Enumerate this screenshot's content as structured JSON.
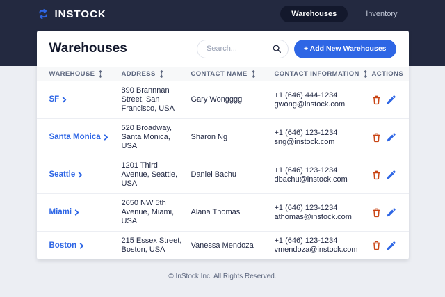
{
  "brand": {
    "name": "INSTOCK"
  },
  "nav": {
    "items": [
      {
        "label": "Warehouses",
        "active": true
      },
      {
        "label": "Inventory",
        "active": false
      }
    ]
  },
  "page": {
    "title": "Warehouses",
    "search_placeholder": "Search...",
    "add_button_label": "+ Add New Warehouses"
  },
  "table": {
    "columns": [
      {
        "label": "WAREHOUSE",
        "sortable": true
      },
      {
        "label": "ADDRESS",
        "sortable": true
      },
      {
        "label": "CONTACT NAME",
        "sortable": true
      },
      {
        "label": "CONTACT INFORMATION",
        "sortable": true
      },
      {
        "label": "ACTIONS",
        "sortable": false
      }
    ],
    "rows": [
      {
        "warehouse": "SF",
        "address": "890 Brannnan Street, San Francisco, USA",
        "contact_name": "Gary Wongggg",
        "phone": "+1 (646) 444-1234",
        "email": "gwong@instock.com"
      },
      {
        "warehouse": "Santa Monica",
        "address": "520 Broadway, Santa Monica, USA",
        "contact_name": "Sharon Ng",
        "phone": "+1 (646) 123-1234",
        "email": "sng@instock.com"
      },
      {
        "warehouse": "Seattle",
        "address": "1201 Third Avenue, Seattle, USA",
        "contact_name": "Daniel Bachu",
        "phone": "+1 (646) 123-1234",
        "email": "dbachu@instock.com"
      },
      {
        "warehouse": "Miami",
        "address": "2650 NW 5th Avenue, Miami, USA",
        "contact_name": "Alana Thomas",
        "phone": "+1 (646) 123-1234",
        "email": "athomas@instock.com"
      },
      {
        "warehouse": "Boston",
        "address": "215 Essex Street, Boston, USA",
        "contact_name": "Vanessa Mendoza",
        "phone": "+1 (646) 123-1234",
        "email": "vmendoza@instock.com"
      }
    ]
  },
  "footer": {
    "copyright": "© InStock Inc. All Rights Reserved."
  },
  "colors": {
    "header_indigo": "#232940",
    "nav_pill_black": "#13182c",
    "accent_blue": "#2e66e5",
    "delete_red": "#c94515",
    "table_header_bg": "#f7f8f9",
    "muted_slate": "#5c667e",
    "page_bg": "#eceef3"
  }
}
